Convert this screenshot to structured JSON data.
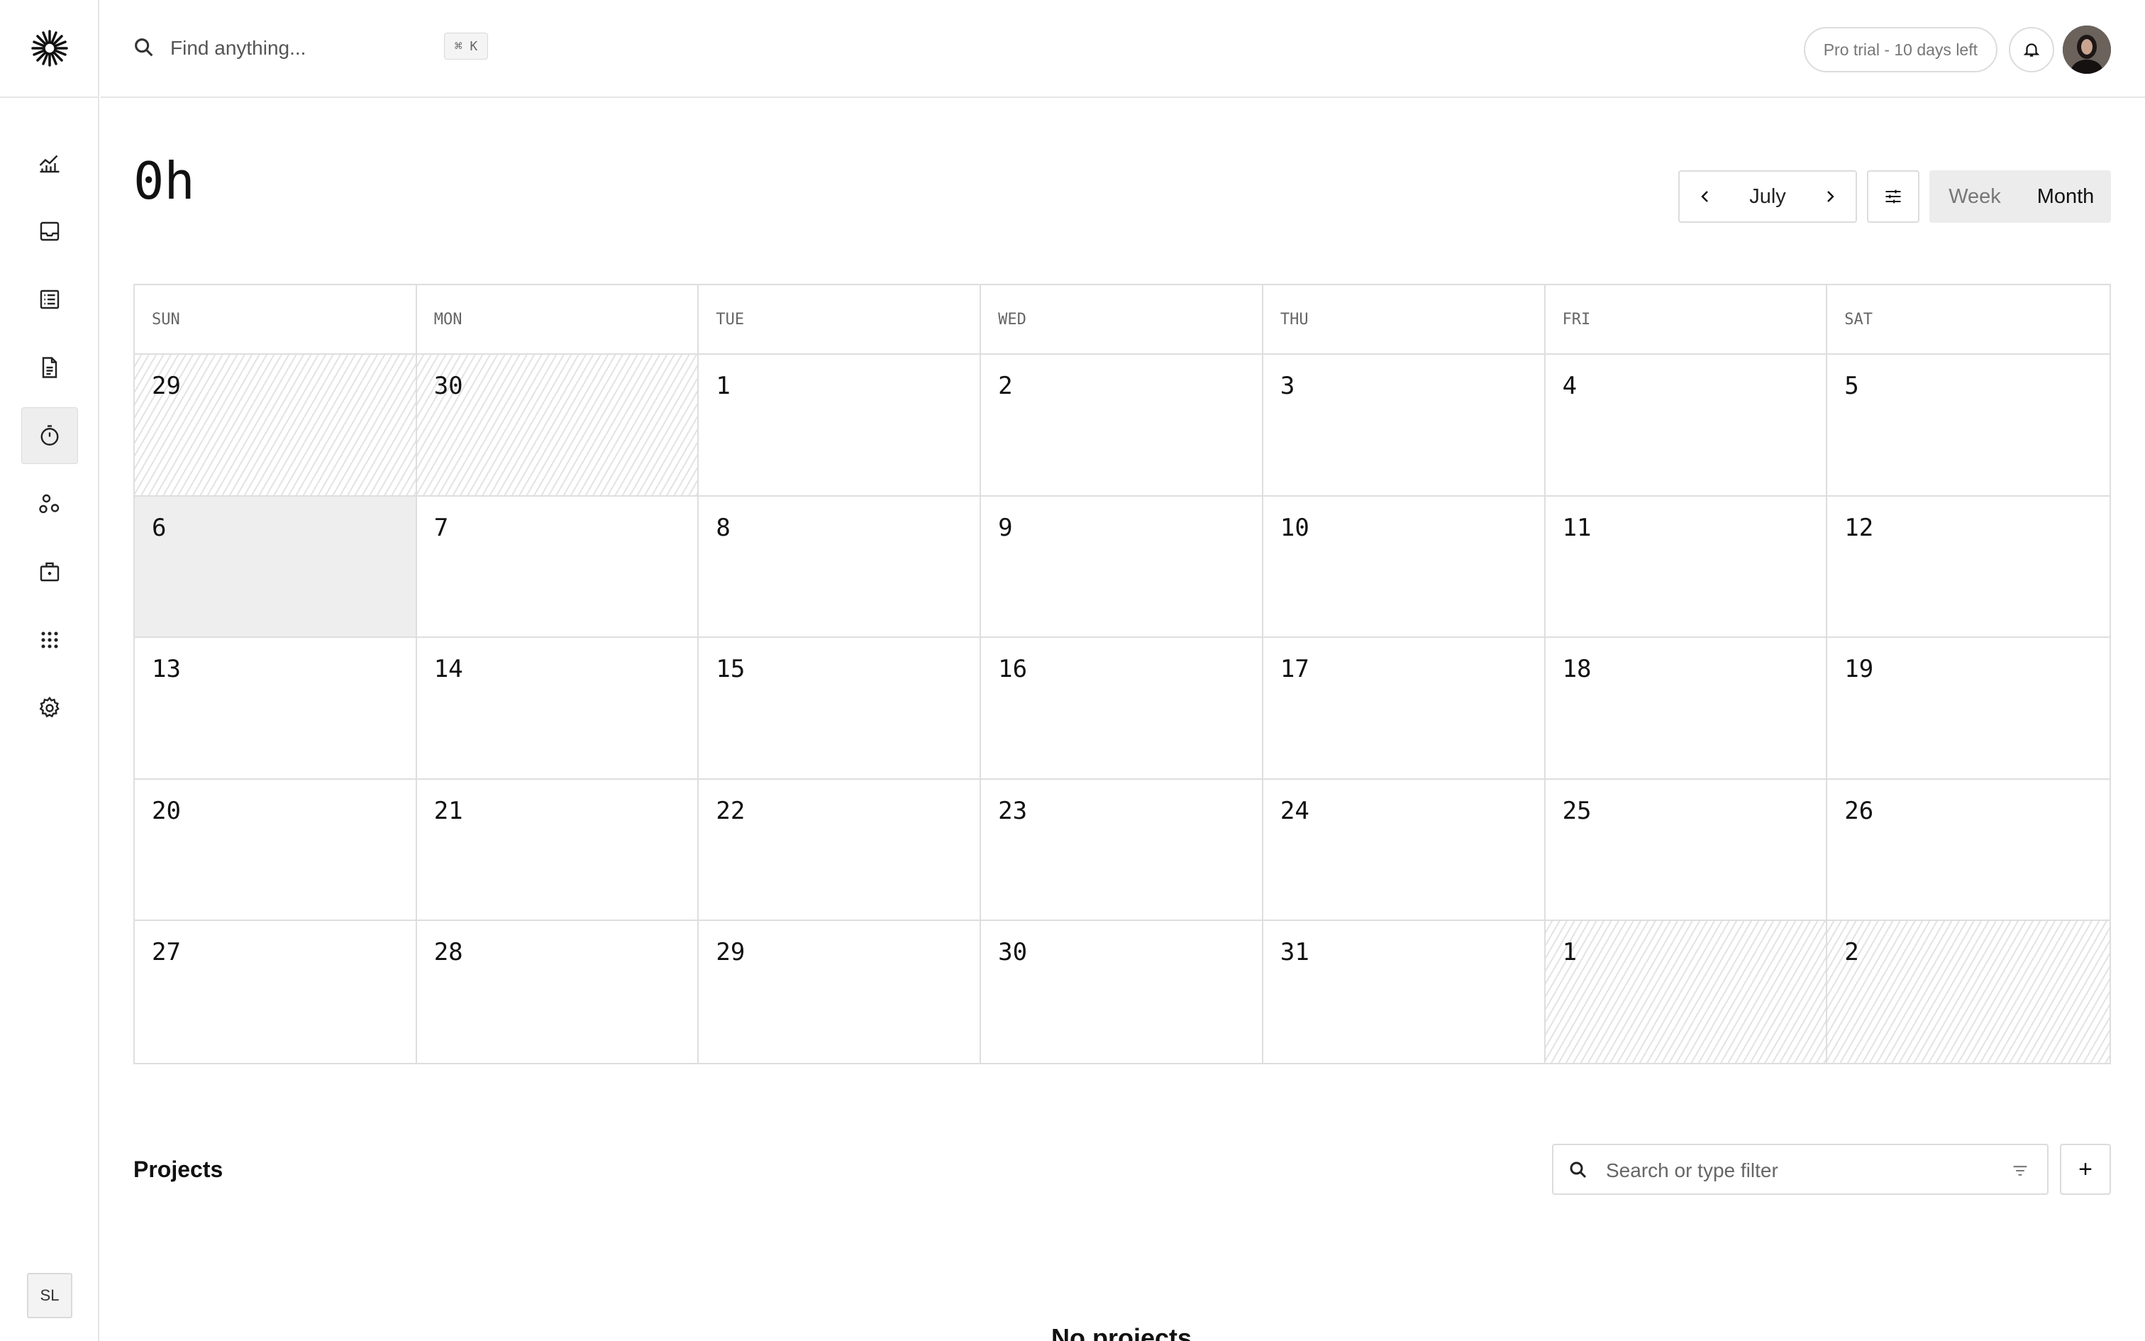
{
  "topbar": {
    "search_placeholder": "Find anything...",
    "shortcut": "⌘ K",
    "trial_text": "Pro trial - 10 days left"
  },
  "sidebar": {
    "items": [
      {
        "icon": "chart-icon"
      },
      {
        "icon": "inbox-icon"
      },
      {
        "icon": "list-icon"
      },
      {
        "icon": "document-icon"
      },
      {
        "icon": "timer-icon",
        "active": true
      },
      {
        "icon": "customers-icon"
      },
      {
        "icon": "briefcase-icon"
      },
      {
        "icon": "apps-grid-icon"
      },
      {
        "icon": "settings-icon"
      }
    ],
    "user_initials": "SL"
  },
  "tracker": {
    "total_hours": "0h",
    "month": "July",
    "views": [
      "Week",
      "Month"
    ],
    "selected_view": "Month"
  },
  "calendar": {
    "weekdays": [
      "SUN",
      "MON",
      "TUE",
      "WED",
      "THU",
      "FRI",
      "SAT"
    ],
    "weeks": [
      [
        {
          "d": "29",
          "outside": true
        },
        {
          "d": "30",
          "outside": true
        },
        {
          "d": "1"
        },
        {
          "d": "2"
        },
        {
          "d": "3"
        },
        {
          "d": "4"
        },
        {
          "d": "5"
        }
      ],
      [
        {
          "d": "6",
          "today": true
        },
        {
          "d": "7"
        },
        {
          "d": "8"
        },
        {
          "d": "9"
        },
        {
          "d": "10"
        },
        {
          "d": "11"
        },
        {
          "d": "12"
        }
      ],
      [
        {
          "d": "13"
        },
        {
          "d": "14"
        },
        {
          "d": "15"
        },
        {
          "d": "16"
        },
        {
          "d": "17"
        },
        {
          "d": "18"
        },
        {
          "d": "19"
        }
      ],
      [
        {
          "d": "20"
        },
        {
          "d": "21"
        },
        {
          "d": "22"
        },
        {
          "d": "23"
        },
        {
          "d": "24"
        },
        {
          "d": "25"
        },
        {
          "d": "26"
        }
      ],
      [
        {
          "d": "27"
        },
        {
          "d": "28"
        },
        {
          "d": "29"
        },
        {
          "d": "30"
        },
        {
          "d": "31"
        },
        {
          "d": "1",
          "outside": true
        },
        {
          "d": "2",
          "outside": true
        }
      ]
    ]
  },
  "projects": {
    "title": "Projects",
    "search_placeholder": "Search or type filter",
    "add_label": "+",
    "empty_text": "No projects"
  }
}
